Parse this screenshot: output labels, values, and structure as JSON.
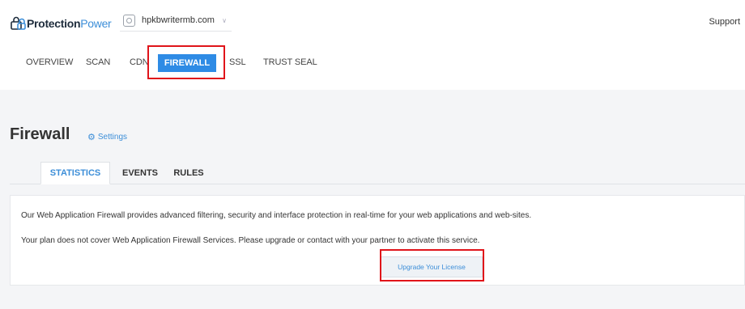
{
  "header": {
    "logo_part1": "Protection",
    "logo_part2": "Power",
    "domain": "hpkbwritermb.com",
    "support_label": "Support"
  },
  "topnav": {
    "items": [
      "OVERVIEW",
      "SCAN",
      "CDN",
      "FIREWALL",
      "SSL",
      "TRUST SEAL"
    ],
    "active": "FIREWALL"
  },
  "page": {
    "title": "Firewall",
    "settings_label": "Settings"
  },
  "tabs": {
    "items": [
      "STATISTICS",
      "EVENTS",
      "RULES"
    ],
    "active": "STATISTICS"
  },
  "card": {
    "description": "Our Web Application Firewall provides advanced filtering, security and interface protection in real-time for your web applications and web-sites.",
    "plan_notice": "Your plan does not cover Web Application Firewall Services. Please upgrade or contact with your partner to activate this service.",
    "upgrade_label": "Upgrade Your License"
  },
  "colors": {
    "accent": "#2e8be5",
    "highlight": "#e0141a"
  }
}
